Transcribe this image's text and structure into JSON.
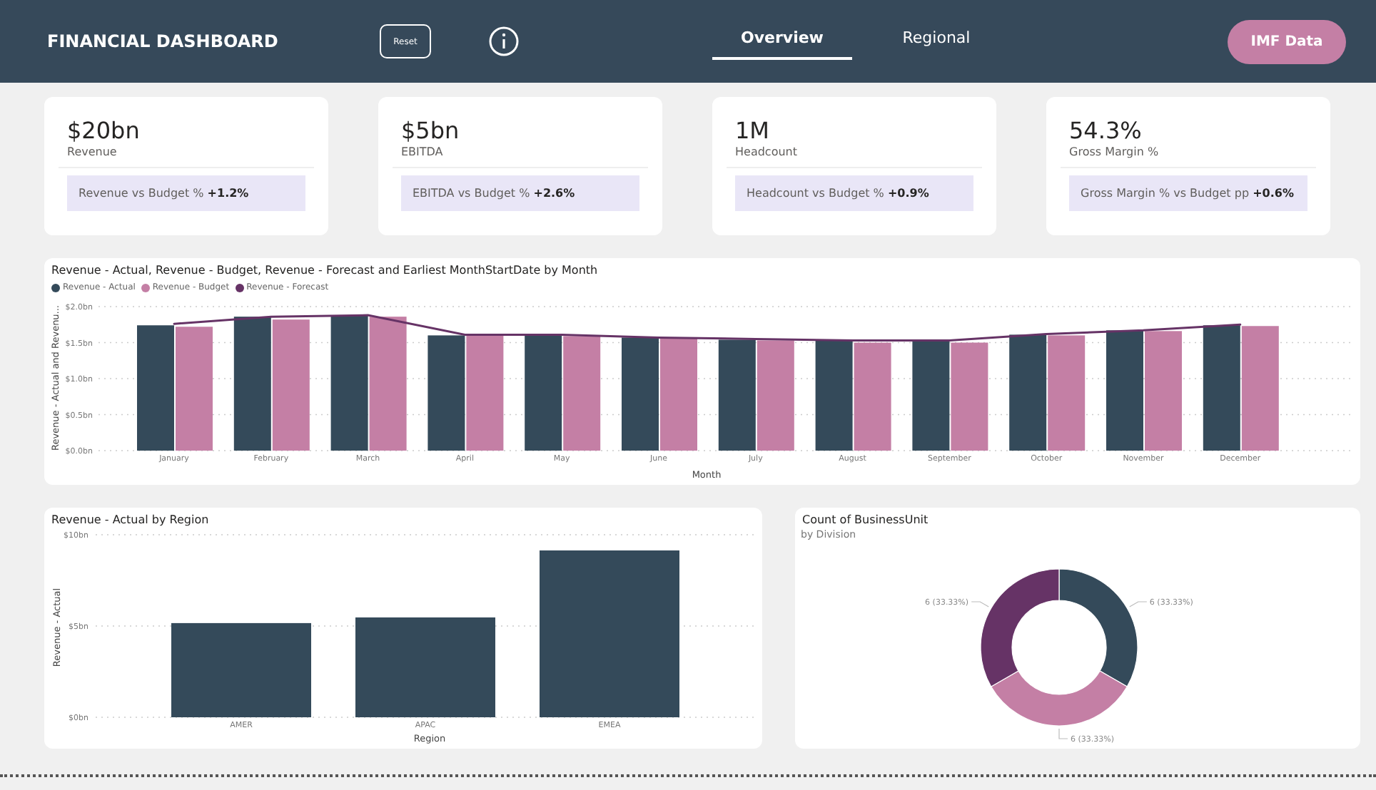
{
  "header": {
    "title": "FINANCIAL DASHBOARD",
    "reset_button": "Reset",
    "tabs": [
      {
        "label": "Overview",
        "selected": true
      },
      {
        "label": "Regional",
        "selected": false
      }
    ],
    "imf_button": "IMF Data"
  },
  "kpis": [
    {
      "value": "$20bn",
      "label": "Revenue",
      "comparison": "Revenue vs Budget % **+1.2%**"
    },
    {
      "value": "$5bn",
      "label": "EBITDA",
      "comparison": "EBITDA vs Budget % **+2.6%**"
    },
    {
      "value": "1M",
      "label": "Headcount",
      "comparison": "Headcount vs Budget % **+0.9%**"
    },
    {
      "value": "54.3%",
      "label": "Gross Margin %",
      "comparison": "Gross Margin % vs Budget pp **+0.6%**"
    }
  ],
  "monthly_chart": {
    "chart_data": {
      "type": "bar",
      "title": "Revenue - Actual, Revenue - Budget, Revenue - Forecast and Earliest MonthStartDate by Month",
      "xlabel": "Month",
      "ylabel": "Revenue - Actual and Revenu...",
      "categories": [
        "January",
        "February",
        "March",
        "April",
        "May",
        "June",
        "July",
        "August",
        "September",
        "October",
        "November",
        "December"
      ],
      "ylim": [
        0,
        2
      ],
      "yticks": [
        {
          "value": 0,
          "label": "$0.0bn"
        },
        {
          "value": 0.5,
          "label": "$0.5bn"
        },
        {
          "value": 1,
          "label": "$1.0bn"
        },
        {
          "value": 1.5,
          "label": "$1.5bn"
        },
        {
          "value": 2,
          "label": "$2.0bn"
        }
      ],
      "grid": true,
      "legend": "top-left",
      "series": [
        {
          "name": "Revenue - Actual",
          "color": "#344a5a",
          "values": [
            1.74,
            1.86,
            1.88,
            1.6,
            1.6,
            1.57,
            1.54,
            1.53,
            1.53,
            1.61,
            1.67,
            1.74
          ]
        },
        {
          "name": "Revenue - Budget",
          "color": "#c47fa5",
          "values": [
            1.72,
            1.82,
            1.86,
            1.6,
            1.59,
            1.56,
            1.53,
            1.5,
            1.5,
            1.6,
            1.66,
            1.73
          ]
        },
        {
          "name": "Revenue - Forecast",
          "color": "#663366",
          "type": "line",
          "values": [
            1.76,
            1.86,
            1.88,
            1.61,
            1.61,
            1.57,
            1.55,
            1.53,
            1.53,
            1.62,
            1.67,
            1.75
          ]
        }
      ]
    }
  },
  "region_chart": {
    "chart_data": {
      "type": "bar",
      "title": "Revenue - Actual by Region",
      "xlabel": "Region",
      "ylabel": "Revenue - Actual",
      "categories": [
        "AMER",
        "APAC",
        "EMEA"
      ],
      "ylim": [
        0,
        10
      ],
      "yticks": [
        {
          "value": 0,
          "label": "$0bn"
        },
        {
          "value": 5,
          "label": "$5bn"
        },
        {
          "value": 10,
          "label": "$10bn"
        }
      ],
      "grid": true,
      "series": [
        {
          "color": "#344a5a",
          "values": [
            5.16,
            5.47,
            9.14
          ]
        }
      ]
    }
  },
  "division_chart": {
    "title": "Count of BusinessUnit",
    "chart_data": {
      "type": "donut",
      "values": [
        33.33,
        33.33,
        33.33
      ],
      "value_labels": [
        "6 (33.33%)",
        "6 (33.33%)",
        "6 (33.33%)"
      ]
    },
    "subtitle": "by Division"
  }
}
